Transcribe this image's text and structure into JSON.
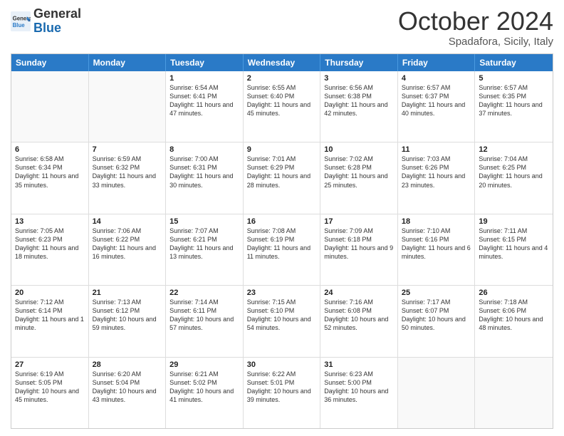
{
  "logo": {
    "line1": "General",
    "line2": "Blue"
  },
  "header": {
    "month": "October 2024",
    "location": "Spadafora, Sicily, Italy"
  },
  "weekdays": [
    "Sunday",
    "Monday",
    "Tuesday",
    "Wednesday",
    "Thursday",
    "Friday",
    "Saturday"
  ],
  "weeks": [
    [
      {
        "day": "",
        "empty": true
      },
      {
        "day": "",
        "empty": true
      },
      {
        "day": "1",
        "info": "Sunrise: 6:54 AM\nSunset: 6:41 PM\nDaylight: 11 hours and 47 minutes."
      },
      {
        "day": "2",
        "info": "Sunrise: 6:55 AM\nSunset: 6:40 PM\nDaylight: 11 hours and 45 minutes."
      },
      {
        "day": "3",
        "info": "Sunrise: 6:56 AM\nSunset: 6:38 PM\nDaylight: 11 hours and 42 minutes."
      },
      {
        "day": "4",
        "info": "Sunrise: 6:57 AM\nSunset: 6:37 PM\nDaylight: 11 hours and 40 minutes."
      },
      {
        "day": "5",
        "info": "Sunrise: 6:57 AM\nSunset: 6:35 PM\nDaylight: 11 hours and 37 minutes."
      }
    ],
    [
      {
        "day": "6",
        "info": "Sunrise: 6:58 AM\nSunset: 6:34 PM\nDaylight: 11 hours and 35 minutes."
      },
      {
        "day": "7",
        "info": "Sunrise: 6:59 AM\nSunset: 6:32 PM\nDaylight: 11 hours and 33 minutes."
      },
      {
        "day": "8",
        "info": "Sunrise: 7:00 AM\nSunset: 6:31 PM\nDaylight: 11 hours and 30 minutes."
      },
      {
        "day": "9",
        "info": "Sunrise: 7:01 AM\nSunset: 6:29 PM\nDaylight: 11 hours and 28 minutes."
      },
      {
        "day": "10",
        "info": "Sunrise: 7:02 AM\nSunset: 6:28 PM\nDaylight: 11 hours and 25 minutes."
      },
      {
        "day": "11",
        "info": "Sunrise: 7:03 AM\nSunset: 6:26 PM\nDaylight: 11 hours and 23 minutes."
      },
      {
        "day": "12",
        "info": "Sunrise: 7:04 AM\nSunset: 6:25 PM\nDaylight: 11 hours and 20 minutes."
      }
    ],
    [
      {
        "day": "13",
        "info": "Sunrise: 7:05 AM\nSunset: 6:23 PM\nDaylight: 11 hours and 18 minutes."
      },
      {
        "day": "14",
        "info": "Sunrise: 7:06 AM\nSunset: 6:22 PM\nDaylight: 11 hours and 16 minutes."
      },
      {
        "day": "15",
        "info": "Sunrise: 7:07 AM\nSunset: 6:21 PM\nDaylight: 11 hours and 13 minutes."
      },
      {
        "day": "16",
        "info": "Sunrise: 7:08 AM\nSunset: 6:19 PM\nDaylight: 11 hours and 11 minutes."
      },
      {
        "day": "17",
        "info": "Sunrise: 7:09 AM\nSunset: 6:18 PM\nDaylight: 11 hours and 9 minutes."
      },
      {
        "day": "18",
        "info": "Sunrise: 7:10 AM\nSunset: 6:16 PM\nDaylight: 11 hours and 6 minutes."
      },
      {
        "day": "19",
        "info": "Sunrise: 7:11 AM\nSunset: 6:15 PM\nDaylight: 11 hours and 4 minutes."
      }
    ],
    [
      {
        "day": "20",
        "info": "Sunrise: 7:12 AM\nSunset: 6:14 PM\nDaylight: 11 hours and 1 minute."
      },
      {
        "day": "21",
        "info": "Sunrise: 7:13 AM\nSunset: 6:12 PM\nDaylight: 10 hours and 59 minutes."
      },
      {
        "day": "22",
        "info": "Sunrise: 7:14 AM\nSunset: 6:11 PM\nDaylight: 10 hours and 57 minutes."
      },
      {
        "day": "23",
        "info": "Sunrise: 7:15 AM\nSunset: 6:10 PM\nDaylight: 10 hours and 54 minutes."
      },
      {
        "day": "24",
        "info": "Sunrise: 7:16 AM\nSunset: 6:08 PM\nDaylight: 10 hours and 52 minutes."
      },
      {
        "day": "25",
        "info": "Sunrise: 7:17 AM\nSunset: 6:07 PM\nDaylight: 10 hours and 50 minutes."
      },
      {
        "day": "26",
        "info": "Sunrise: 7:18 AM\nSunset: 6:06 PM\nDaylight: 10 hours and 48 minutes."
      }
    ],
    [
      {
        "day": "27",
        "info": "Sunrise: 6:19 AM\nSunset: 5:05 PM\nDaylight: 10 hours and 45 minutes."
      },
      {
        "day": "28",
        "info": "Sunrise: 6:20 AM\nSunset: 5:04 PM\nDaylight: 10 hours and 43 minutes."
      },
      {
        "day": "29",
        "info": "Sunrise: 6:21 AM\nSunset: 5:02 PM\nDaylight: 10 hours and 41 minutes."
      },
      {
        "day": "30",
        "info": "Sunrise: 6:22 AM\nSunset: 5:01 PM\nDaylight: 10 hours and 39 minutes."
      },
      {
        "day": "31",
        "info": "Sunrise: 6:23 AM\nSunset: 5:00 PM\nDaylight: 10 hours and 36 minutes."
      },
      {
        "day": "",
        "empty": true
      },
      {
        "day": "",
        "empty": true
      }
    ]
  ]
}
